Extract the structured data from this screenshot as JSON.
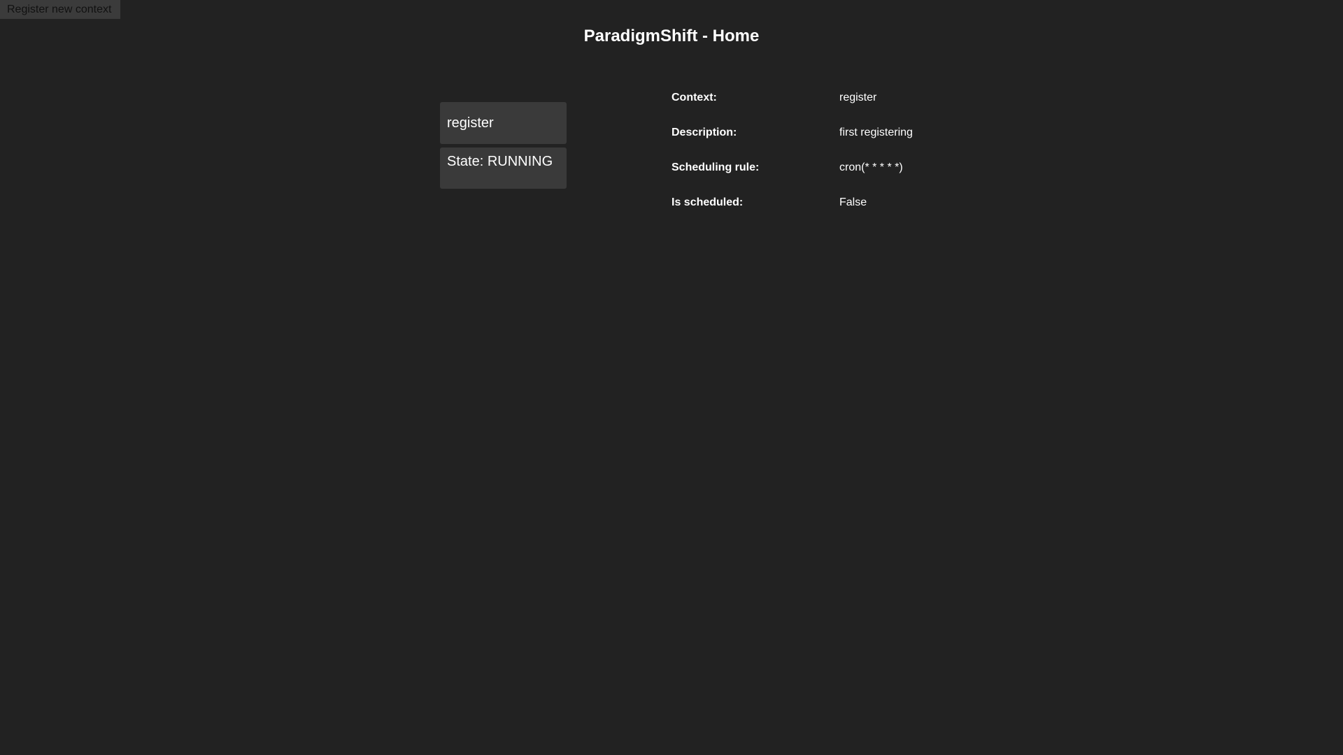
{
  "topbar": {
    "register_button_label": "Register new context"
  },
  "header": {
    "title": "ParadigmShift - Home"
  },
  "context_card": {
    "name": "register",
    "state_text": "State: RUNNING"
  },
  "details": {
    "rows": [
      {
        "label": "Context:",
        "value": "register"
      },
      {
        "label": "Description:",
        "value": "first registering"
      },
      {
        "label": "Scheduling rule:",
        "value": "cron(* * * * *)"
      },
      {
        "label": "Is scheduled:",
        "value": "False"
      }
    ]
  },
  "colors": {
    "background": "#222222",
    "card": "#3a3a3a",
    "button": "#3b3b3b",
    "text": "#ffffff"
  }
}
